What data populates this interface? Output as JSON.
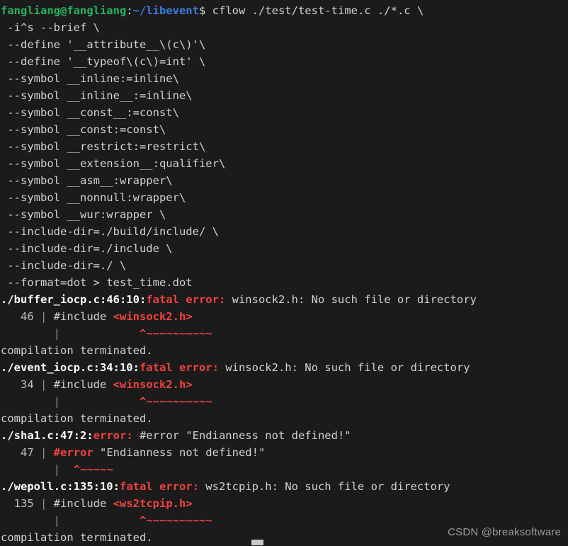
{
  "terminal": {
    "background": "#1b1b1b",
    "foreground": "#d2d2d2",
    "error_color": "#f1423f",
    "prompt": {
      "user_host": "fangliang@fangliang",
      "separator": ":",
      "path": "~/libevent",
      "sigil": "$ ",
      "command_first_line": "cflow ./test/test-time.c ./*.c \\"
    },
    "command_continuation": [
      " -i^s --brief \\",
      " --define '__attribute__\\(c\\)'\\",
      " --define '__typeof\\(c\\)=int' \\",
      " --symbol __inline:=inline\\",
      " --symbol __inline__:=inline\\",
      " --symbol __const__:=const\\",
      " --symbol __const:=const\\",
      " --symbol __restrict:=restrict\\",
      " --symbol __extension__:qualifier\\",
      " --symbol __asm__:wrapper\\",
      " --symbol __nonnull:wrapper\\",
      " --symbol __wur:wrapper \\",
      " --include-dir=./build/include/ \\",
      " --include-dir=./include \\",
      " --include-dir=./ \\",
      " --format=dot > test_time.dot"
    ],
    "diagnostics": [
      {
        "location": "./buffer_iocp.c:46:10:",
        "severity": "fatal error:",
        "message": " winsock2.h: No such file or directory",
        "line_number": "   46",
        "gutter": " | ",
        "code_prefix": "#include ",
        "code_highlight": "<winsock2.h>",
        "marker_indent": "        |            ",
        "marker": "^~~~~~~~~~~",
        "terminated": "compilation terminated."
      },
      {
        "location": "./event_iocp.c:34:10:",
        "severity": "fatal error:",
        "message": " winsock2.h: No such file or directory",
        "line_number": "   34",
        "gutter": " | ",
        "code_prefix": "#include ",
        "code_highlight": "<winsock2.h>",
        "marker_indent": "        |            ",
        "marker": "^~~~~~~~~~~",
        "terminated": "compilation terminated."
      },
      {
        "location": "./sha1.c:47:2:",
        "severity": "error:",
        "message": " #error \"Endianness not defined!\"",
        "line_number": "   47",
        "gutter": " | ",
        "code_prefix": "",
        "code_highlight": "#error",
        "code_suffix": " \"Endianness not defined!\"",
        "marker_indent": "        |  ",
        "marker": "^~~~~~",
        "terminated": ""
      },
      {
        "location": "./wepoll.c:135:10:",
        "severity": "fatal error:",
        "message": " ws2tcpip.h: No such file or directory",
        "line_number": "  135",
        "gutter": " | ",
        "code_prefix": "#include ",
        "code_highlight": "<ws2tcpip.h>",
        "marker_indent": "        |            ",
        "marker": "^~~~~~~~~~~",
        "terminated": "compilation terminated."
      }
    ],
    "empty_gutter": "        |",
    "watermark": "CSDN @breaksoftware"
  }
}
